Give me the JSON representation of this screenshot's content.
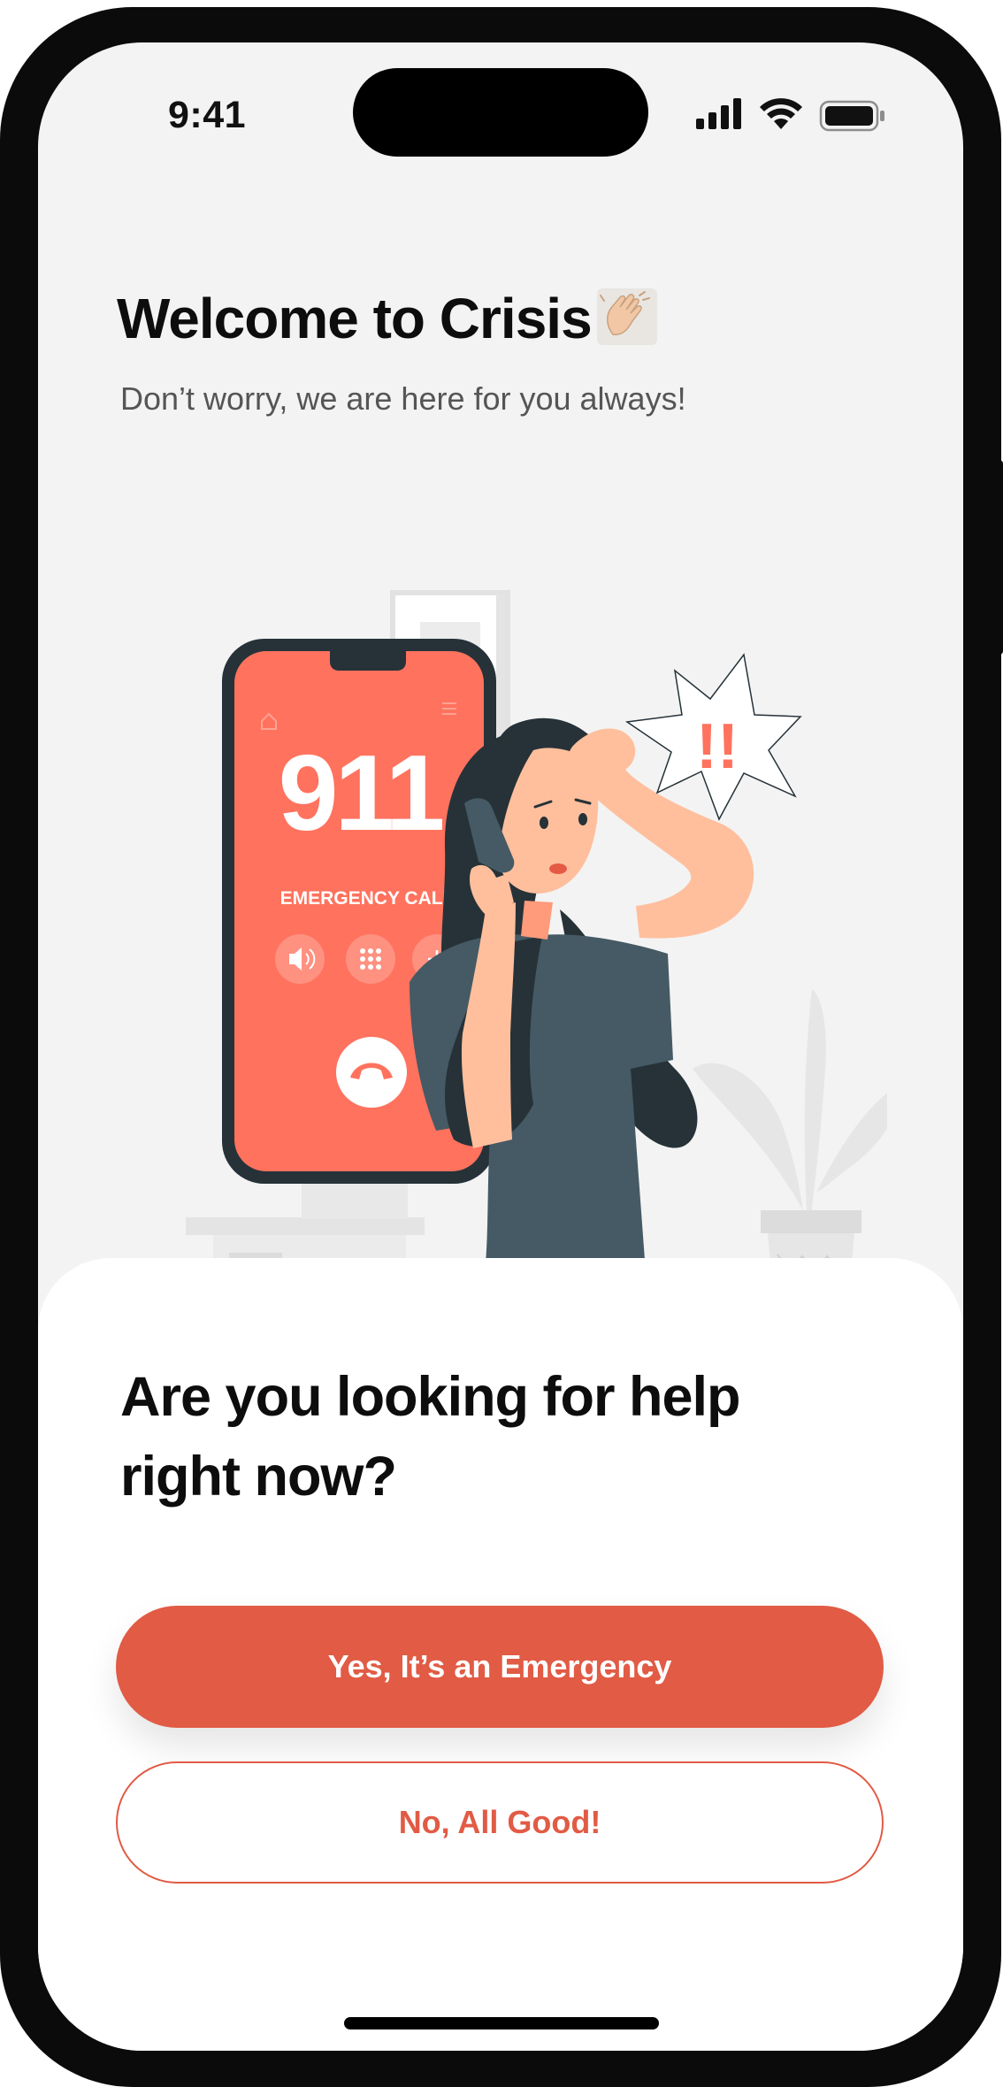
{
  "status_bar": {
    "time": "9:41"
  },
  "header": {
    "title": "Welcome to Crisis",
    "subtitle": "Don’t worry, we are here for you always!"
  },
  "illustration": {
    "phone_number": "911",
    "phone_caption": "EMERGENCY CALL",
    "alert_text": "!!"
  },
  "sheet": {
    "question_line1": "Are you looking for help",
    "question_line2": "right now?",
    "yes_label": "Yes, It’s an Emergency",
    "no_label": "No, All Good!"
  },
  "colors": {
    "accent": "#e15b45",
    "phone_screen": "#ff725e",
    "background": "#f3f3f3"
  }
}
